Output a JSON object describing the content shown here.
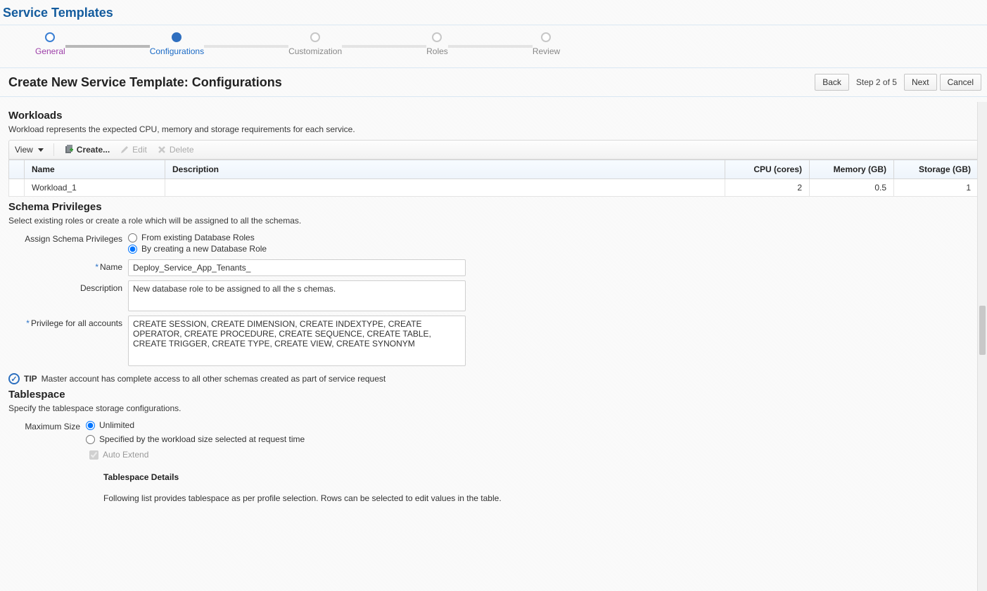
{
  "pageTitle": "Service Templates",
  "wizard": {
    "steps": [
      {
        "label": "General",
        "state": "done"
      },
      {
        "label": "Configurations",
        "state": "active"
      },
      {
        "label": "Customization",
        "state": "future"
      },
      {
        "label": "Roles",
        "state": "future"
      },
      {
        "label": "Review",
        "state": "future"
      }
    ]
  },
  "header2": {
    "title": "Create New Service Template: Configurations",
    "back": "Back",
    "stepText": "Step 2 of 5",
    "next": "Next",
    "cancel": "Cancel"
  },
  "workloads": {
    "title": "Workloads",
    "desc": "Workload represents the expected CPU, memory and storage requirements for each service.",
    "toolbar": {
      "view": "View",
      "create": "Create...",
      "edit": "Edit",
      "delete": "Delete"
    },
    "columns": {
      "name": "Name",
      "description": "Description",
      "cpu": "CPU (cores)",
      "memory": "Memory (GB)",
      "storage": "Storage (GB)"
    },
    "rows": [
      {
        "name": "Workload_1",
        "description": "",
        "cpu": "2",
        "memory": "0.5",
        "storage": "1"
      }
    ]
  },
  "schema": {
    "title": "Schema Privileges",
    "desc": "Select existing roles or create a role which will be assigned to all the schemas.",
    "assignLabel": "Assign Schema Privileges",
    "opt1": "From existing Database Roles",
    "opt2": "By creating a new Database Role",
    "nameLabel": "Name",
    "nameValue": "Deploy_Service_App_Tenants_",
    "descLabel": "Description",
    "descValue": "New database role to be assigned to all the s chemas.",
    "privLabel": "Privilege for all accounts",
    "privValue": "CREATE SESSION, CREATE DIMENSION, CREATE INDEXTYPE, CREATE OPERATOR, CREATE PROCEDURE, CREATE SEQUENCE, CREATE TABLE, CREATE TRIGGER, CREATE TYPE, CREATE VIEW, CREATE SYNONYM",
    "tipLabel": "TIP",
    "tipText": "Master account has complete access to all other schemas created as part of service request"
  },
  "tablespace": {
    "title": "Tablespace",
    "desc": "Specify the tablespace storage configurations.",
    "maxSizeLabel": "Maximum Size",
    "opt1": "Unlimited",
    "opt2": "Specified by the workload size selected at request time",
    "autoExtend": "Auto Extend",
    "detailsTitle": "Tablespace Details",
    "detailsDesc": "Following list provides tablespace as per profile selection. Rows can be selected to edit values in the table."
  }
}
